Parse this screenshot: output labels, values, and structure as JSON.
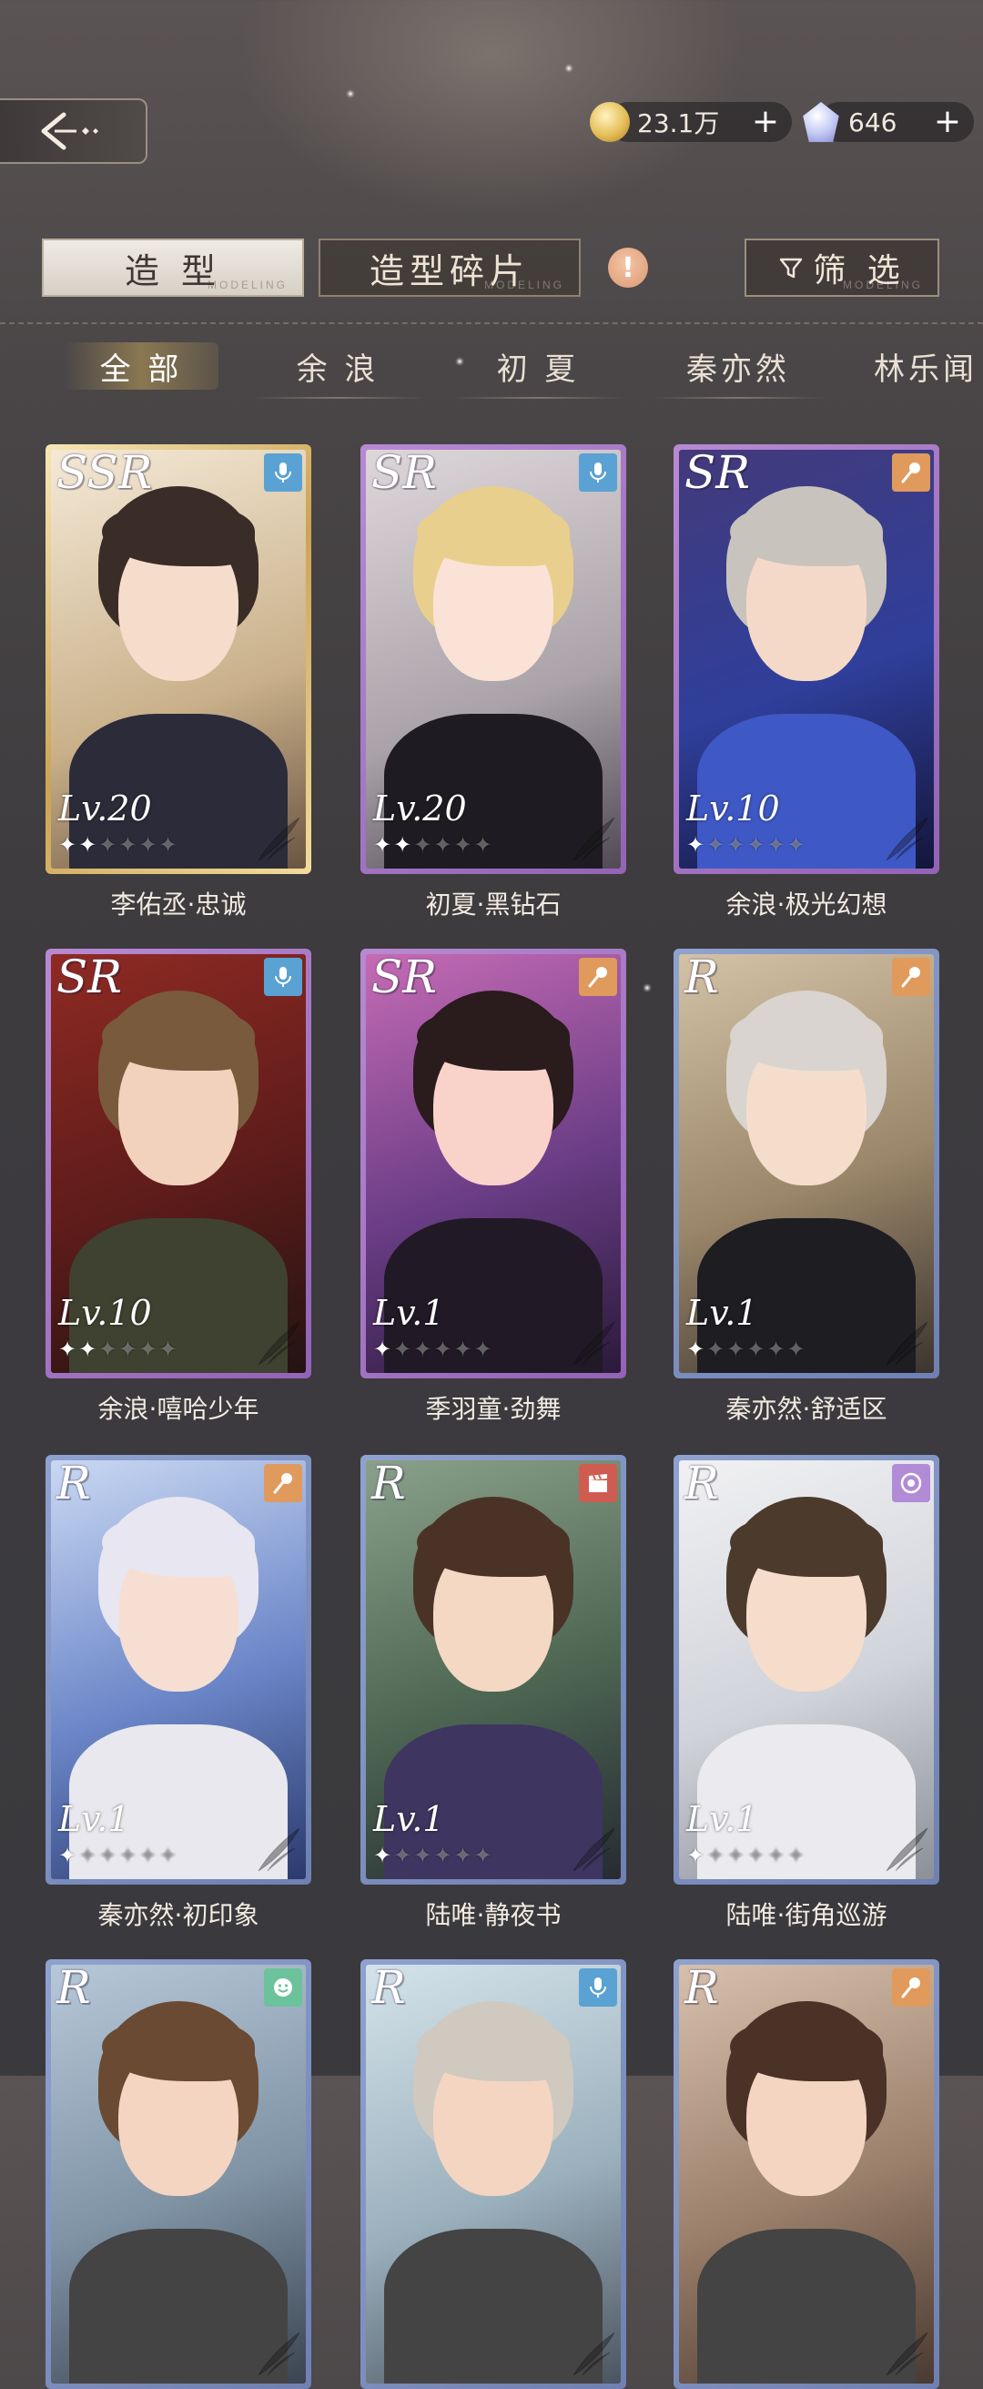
{
  "header": {
    "back_label": "",
    "gold": {
      "icon": "gold-coin-icon",
      "value": "23.1万",
      "plus": "+"
    },
    "gem": {
      "icon": "crystal-icon",
      "value": "646",
      "plus": "+"
    }
  },
  "tabs": {
    "main": [
      {
        "label": "造 型",
        "sub": "MODELING",
        "active": true
      },
      {
        "label": "造型碎片",
        "sub": "MODELING",
        "active": false
      }
    ],
    "alert": "!",
    "filter_label": "筛 选",
    "filter_sub": "MODELING"
  },
  "characters": [
    {
      "label": "全 部",
      "active": true
    },
    {
      "label": "余 浪",
      "active": false
    },
    {
      "label": "初 夏",
      "active": false
    },
    {
      "label": "秦亦然",
      "active": false
    },
    {
      "label": "林乐闻",
      "active": false
    }
  ],
  "cards": [
    {
      "rarity": "SSR",
      "type_icon": "microphone-icon",
      "type_color": "blue",
      "level": "Lv.20",
      "stars": 2,
      "name": "李佑丞·忠诚"
    },
    {
      "rarity": "SR",
      "type_icon": "microphone-icon",
      "type_color": "blue",
      "level": "Lv.20",
      "stars": 2,
      "name": "初夏·黑钻石"
    },
    {
      "rarity": "SR",
      "type_icon": "handheld-mic-icon",
      "type_color": "orange",
      "level": "Lv.10",
      "stars": 1,
      "name": "余浪·极光幻想"
    },
    {
      "rarity": "SR",
      "type_icon": "microphone-icon",
      "type_color": "blue",
      "level": "Lv.10",
      "stars": 2,
      "name": "余浪·嘻哈少年"
    },
    {
      "rarity": "SR",
      "type_icon": "handheld-mic-icon",
      "type_color": "orange",
      "level": "Lv.1",
      "stars": 1,
      "name": "季羽童·劲舞"
    },
    {
      "rarity": "R",
      "type_icon": "handheld-mic-icon",
      "type_color": "orange",
      "level": "Lv.1",
      "stars": 1,
      "name": "秦亦然·舒适区"
    },
    {
      "rarity": "R",
      "type_icon": "handheld-mic-icon",
      "type_color": "orange",
      "level": "Lv.1",
      "stars": 1,
      "name": "秦亦然·初印象"
    },
    {
      "rarity": "R",
      "type_icon": "clapperboard-icon",
      "type_color": "red",
      "level": "Lv.1",
      "stars": 1,
      "name": "陆唯·静夜书"
    },
    {
      "rarity": "R",
      "type_icon": "record-icon",
      "type_color": "purple",
      "level": "Lv.1",
      "stars": 1,
      "name": "陆唯·街角巡游"
    },
    {
      "rarity": "R",
      "type_icon": "smile-icon",
      "type_color": "green",
      "level": "",
      "stars": 0,
      "name": ""
    },
    {
      "rarity": "R",
      "type_icon": "microphone-icon",
      "type_color": "blue",
      "level": "",
      "stars": 0,
      "name": ""
    },
    {
      "rarity": "R",
      "type_icon": "handheld-mic-icon",
      "type_color": "orange",
      "level": "",
      "stars": 0,
      "name": ""
    }
  ],
  "star_glyph": "✦",
  "colors": {
    "ssr_frame": "#cba455",
    "sr_frame": "#9363b6",
    "r_frame": "#6f80b2",
    "accent_gold": "#bfa060"
  }
}
